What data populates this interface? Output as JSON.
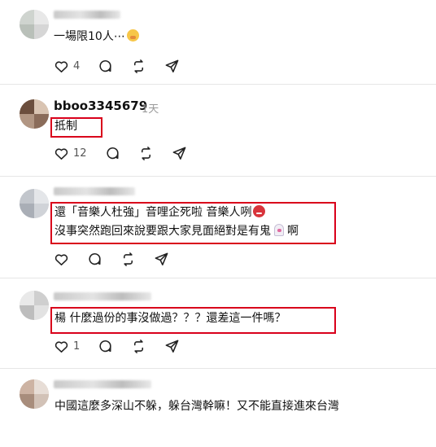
{
  "posts": [
    {
      "username": "",
      "time": "",
      "text_lines": [
        "一場限10人⋯"
      ],
      "emoji": "grimacing-emoji",
      "actions": {
        "like_count": "4",
        "comment_count": "",
        "repost_count": "",
        "share_count": ""
      },
      "highlighted": false
    },
    {
      "username": "bboo3345679",
      "time": "1天",
      "text_lines": [
        "抵制"
      ],
      "actions": {
        "like_count": "12",
        "comment_count": "",
        "repost_count": "",
        "share_count": ""
      },
      "highlighted": true
    },
    {
      "username": "",
      "time": "",
      "text_lines": [
        "還「音樂人杜強」音哩企死啦 音樂人咧",
        "沒事突然跑回來說要跟大家見面絕對是有鬼",
        "啊"
      ],
      "actions": {
        "like_count": "",
        "comment_count": "",
        "repost_count": "",
        "share_count": ""
      },
      "highlighted": true
    },
    {
      "username": "",
      "time": "",
      "text_lines": [
        "楊 什麼過份的事沒做過？？？還差這一件嗎？"
      ],
      "actions": {
        "like_count": "1",
        "comment_count": "",
        "repost_count": "",
        "share_count": ""
      },
      "highlighted": true
    },
    {
      "username": "",
      "time": "",
      "text_lines": [
        "中國這麼多深山不躲，躲台灣幹嘛！又不能直接進來台灣"
      ],
      "actions": {
        "like_count": "",
        "comment_count": "",
        "repost_count": "",
        "share_count": ""
      },
      "highlighted": false
    }
  ],
  "icons": {
    "like": "heart-icon",
    "comment": "comment-icon",
    "repost": "repost-icon",
    "share": "share-icon"
  },
  "colors": {
    "highlight_box": "#d9001b",
    "secondary_text": "#9a9a9a",
    "divider": "#e6e6e6"
  }
}
